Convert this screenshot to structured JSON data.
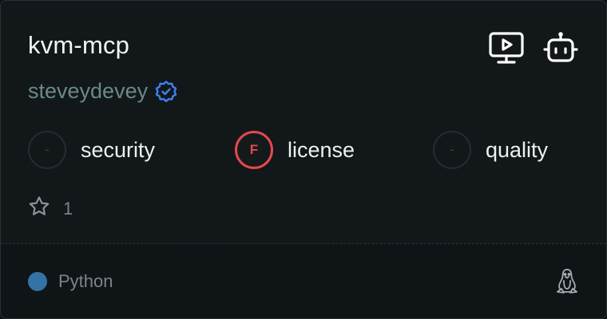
{
  "server": {
    "name": "kvm-mcp",
    "author": "steveydevey",
    "verified": true
  },
  "actions": [
    {
      "icon": "monitor-play-icon"
    },
    {
      "icon": "robot-icon"
    }
  ],
  "scores": [
    {
      "grade": "-",
      "label": "security",
      "status": "none"
    },
    {
      "grade": "F",
      "label": "license",
      "status": "fail"
    },
    {
      "grade": "-",
      "label": "quality",
      "status": "none"
    }
  ],
  "stars": {
    "count": "1",
    "icon": "star-icon"
  },
  "footer": {
    "language": "Python",
    "language_color": "#3572a5",
    "os_icon": "linux-tux-icon"
  },
  "colors": {
    "fail": "#e5484d",
    "verified": "#3b82f6"
  }
}
